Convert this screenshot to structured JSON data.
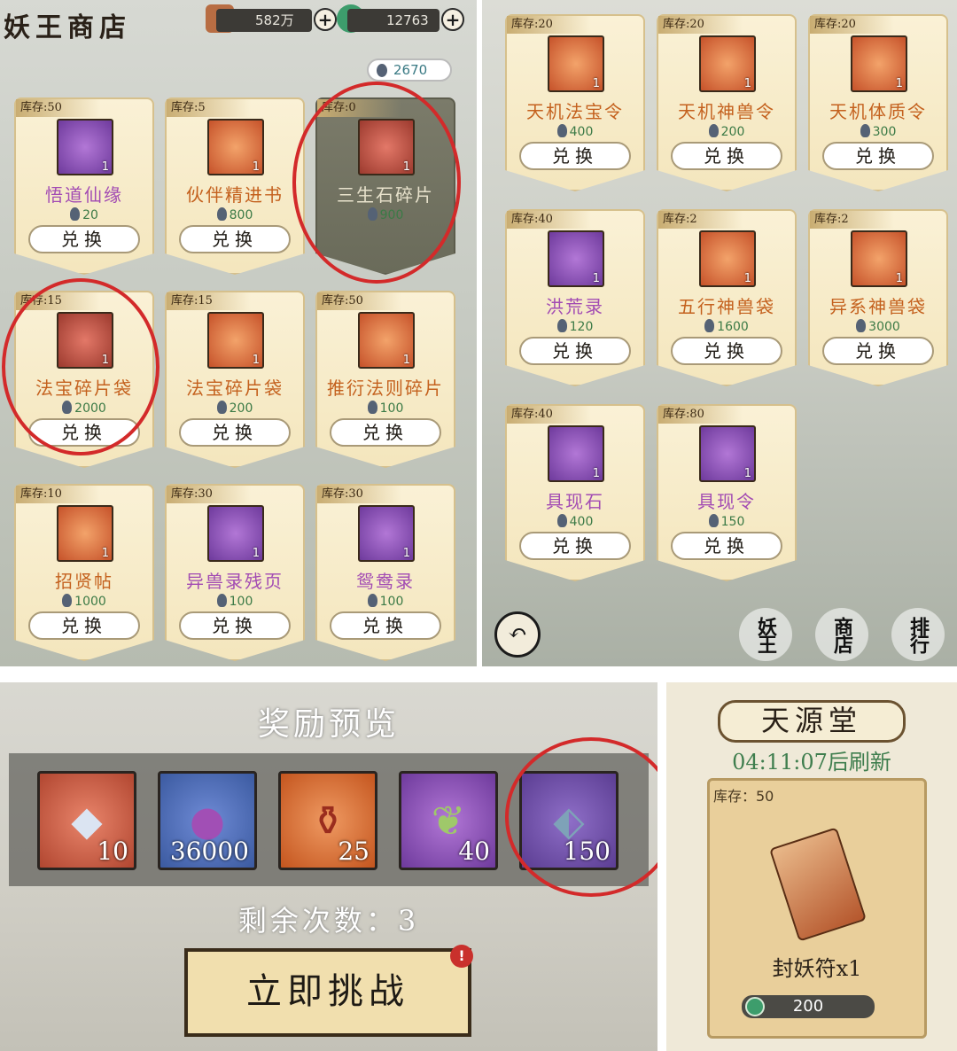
{
  "panel1": {
    "title": "妖王商店",
    "currency1": "582万",
    "currency2": "12763",
    "balance": "2670",
    "items": [
      {
        "stock": "库存:50",
        "name": "悟道仙缘",
        "price": "20",
        "qty": "1",
        "style": "purple",
        "btn": "兑换"
      },
      {
        "stock": "库存:5",
        "name": "伙伴精进书",
        "price": "800",
        "qty": "1",
        "style": "orange",
        "btn": "兑换"
      },
      {
        "stock": "库存:0",
        "name": "三生石碎片",
        "price": "900",
        "qty": "1",
        "style": "empty",
        "btn": ""
      },
      {
        "stock": "库存:15",
        "name": "法宝碎片袋",
        "price": "2000",
        "qty": "1",
        "style": "red",
        "btn": "兑换"
      },
      {
        "stock": "库存:15",
        "name": "法宝碎片袋",
        "price": "200",
        "qty": "1",
        "style": "orange",
        "btn": "兑换"
      },
      {
        "stock": "库存:50",
        "name": "推衍法则碎片",
        "price": "100",
        "qty": "1",
        "style": "orange",
        "btn": "兑换"
      },
      {
        "stock": "库存:10",
        "name": "招贤帖",
        "price": "1000",
        "qty": "1",
        "style": "orange",
        "btn": "兑换"
      },
      {
        "stock": "库存:30",
        "name": "异兽录残页",
        "price": "100",
        "qty": "1",
        "style": "purple",
        "btn": "兑换"
      },
      {
        "stock": "库存:30",
        "name": "鸳鸯录",
        "price": "100",
        "qty": "1",
        "style": "purple",
        "btn": "兑换"
      }
    ]
  },
  "panel2": {
    "items": [
      {
        "stock": "库存:20",
        "name": "天机法宝令",
        "price": "400",
        "qty": "1",
        "style": "orange",
        "btn": "兑换"
      },
      {
        "stock": "库存:20",
        "name": "天机神兽令",
        "price": "200",
        "qty": "1",
        "style": "orange",
        "btn": "兑换"
      },
      {
        "stock": "库存:20",
        "name": "天机体质令",
        "price": "300",
        "qty": "1",
        "style": "orange",
        "btn": "兑换"
      },
      {
        "stock": "库存:40",
        "name": "洪荒录",
        "price": "120",
        "qty": "1",
        "style": "purple",
        "btn": "兑换"
      },
      {
        "stock": "库存:2",
        "name": "五行神兽袋",
        "price": "1600",
        "qty": "1",
        "style": "orange",
        "btn": "兑换"
      },
      {
        "stock": "库存:2",
        "name": "异系神兽袋",
        "price": "3000",
        "qty": "1",
        "style": "orange",
        "btn": "兑换"
      },
      {
        "stock": "库存:40",
        "name": "具现石",
        "price": "400",
        "qty": "1",
        "style": "purple",
        "btn": "兑换"
      },
      {
        "stock": "库存:80",
        "name": "具现令",
        "price": "150",
        "qty": "1",
        "style": "purple",
        "btn": "兑换"
      }
    ],
    "nav": [
      "妖王",
      "商店",
      "排行"
    ]
  },
  "panel3": {
    "title": "奖励预览",
    "rewards": [
      {
        "count": "10",
        "icon": "crystal-icon"
      },
      {
        "count": "36000",
        "icon": "orb-icon"
      },
      {
        "count": "25",
        "icon": "potion-icon"
      },
      {
        "count": "40",
        "icon": "jade-icon"
      },
      {
        "count": "150",
        "icon": "stone-shard-icon"
      }
    ],
    "remaining": "剩余次数：3",
    "button": "立即挑战",
    "alert": "!"
  },
  "panel4": {
    "title": "天源堂",
    "refresh": "04:11:07后刷新",
    "stock": "库存：50",
    "item_name": "封妖符x1",
    "price": "200"
  }
}
